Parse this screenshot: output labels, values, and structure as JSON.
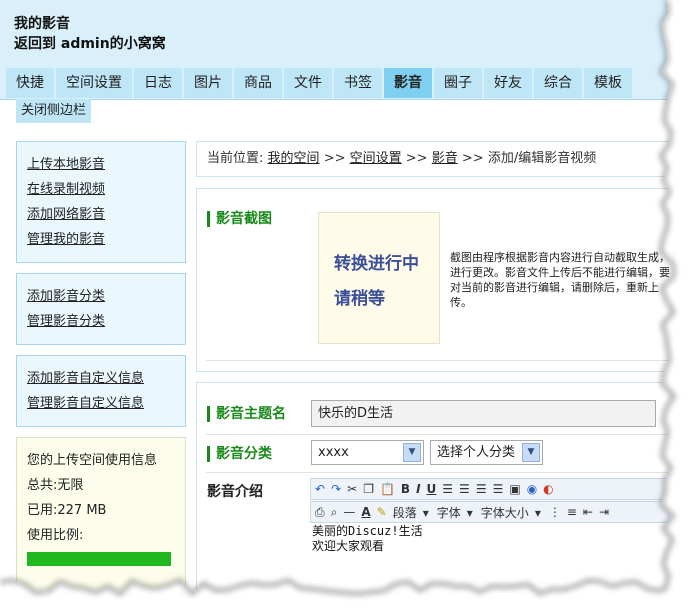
{
  "header": {
    "title": "我的影音",
    "back_link": "返回到 admin的小窝窝"
  },
  "tabs": [
    "快捷",
    "空间设置",
    "日志",
    "图片",
    "商品",
    "文件",
    "书签",
    "影音",
    "圈子",
    "好友",
    "综合",
    "模板"
  ],
  "active_tab": "影音",
  "close_sidebar": "关闭侧边栏",
  "sidebar": {
    "group1": [
      "上传本地影音",
      "在线录制视频",
      "添加网络影音",
      "管理我的影音"
    ],
    "group2": [
      "添加影音分类",
      "管理影音分类"
    ],
    "group3": [
      "添加影音自定义信息",
      "管理影音自定义信息"
    ],
    "usage": {
      "title": "您的上传空间使用信息",
      "total": "总共:无限",
      "used": "已用:227 MB",
      "ratio_label": "使用比例:"
    }
  },
  "breadcrumb": {
    "prefix": "当前位置:",
    "items": [
      "我的空间",
      "空间设置",
      "影音"
    ],
    "sep": ">>",
    "current": "添加/编辑影音视频"
  },
  "screenshot": {
    "label": "影音截图",
    "thumb_line1": "转换进行中",
    "thumb_line2": "请稍等",
    "description": "截图由程序根据影音内容进行自动截取生成，进行更改。影音文件上传后不能进行编辑，要对当前的影音进行编辑，请删除后，重新上传。"
  },
  "form": {
    "title_label": "影音主题名",
    "title_value": "快乐的D生活",
    "category_label": "影音分类",
    "category_value": "xxxx",
    "personal_category": "选择个人分类",
    "intro_label": "影音介绍"
  },
  "editor": {
    "paragraph": "段落",
    "font": "字体",
    "font_size": "字体大小",
    "content_line1": "美丽的Discuz!生活",
    "content_line2": "欢迎大家观看"
  },
  "colors": {
    "header_bg": "#d9f0fb",
    "tab_bg": "#bfe6f6",
    "tab_active": "#7fcff0",
    "label_green": "#1a8a1a",
    "usage_bar": "#1fb81f"
  }
}
